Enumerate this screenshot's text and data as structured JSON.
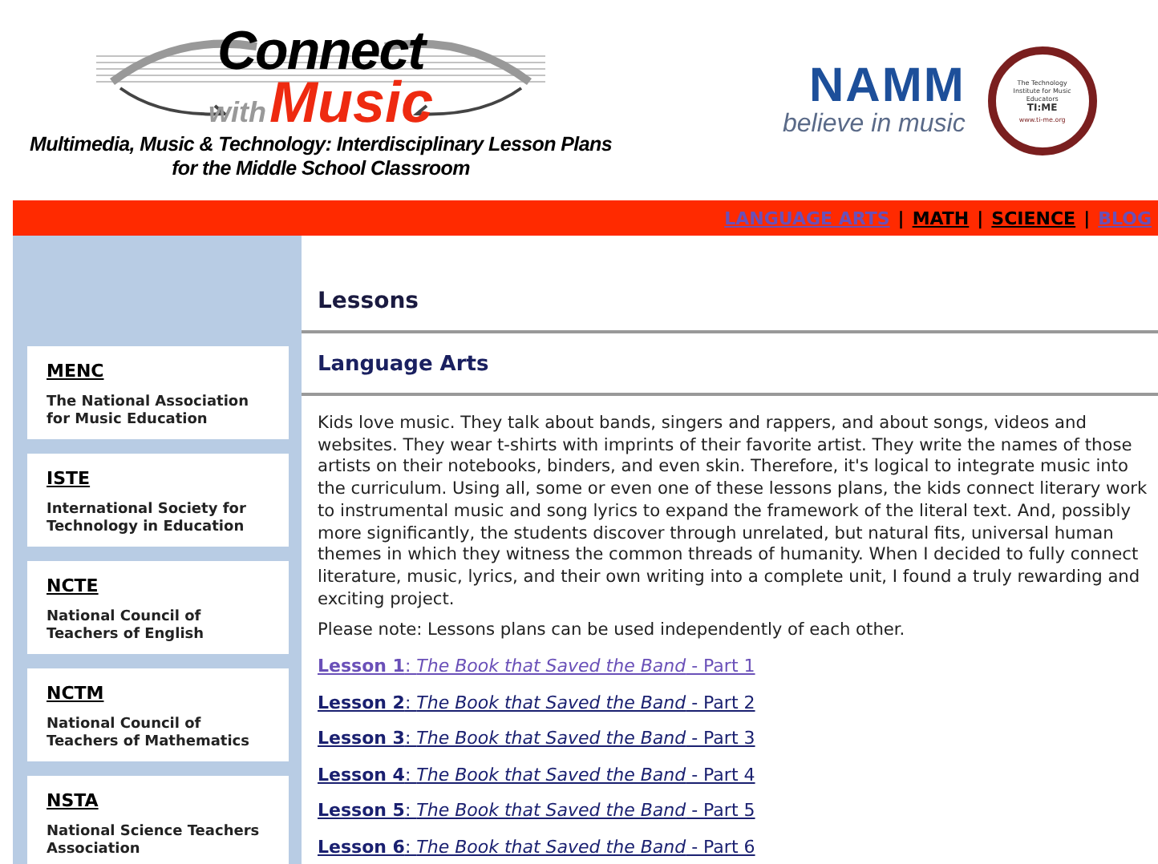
{
  "header": {
    "logo": {
      "top": "Connect",
      "middle": "with",
      "bottom": "Music"
    },
    "tagline": [
      "Multimedia, Music & Technology:  Interdisciplinary Lesson Plans",
      "for the Middle School Classroom"
    ],
    "namm": {
      "name": "NAMM",
      "slogan": "believe in music"
    },
    "time_badge": {
      "caption": "The Technology Institute for Music Educators",
      "name": "TI:ME",
      "url": "www.ti-me.org"
    }
  },
  "nav": [
    {
      "label": "LANGUAGE ARTS",
      "visited": true
    },
    {
      "label": "MATH",
      "visited": false
    },
    {
      "label": "SCIENCE",
      "visited": false
    },
    {
      "label": "BLOG",
      "visited": true
    }
  ],
  "nav_separator": "|",
  "sidebar": [
    {
      "abbr": "MENC",
      "name": "The National Association for Music Education"
    },
    {
      "abbr": "ISTE",
      "name": "International Society for Technology in Education"
    },
    {
      "abbr": "NCTE",
      "name": "National Council of Teachers of English"
    },
    {
      "abbr": "NCTM",
      "name": "National Council of Teachers of Mathematics"
    },
    {
      "abbr": "NSTA",
      "name": "National Science Teachers Association"
    }
  ],
  "main": {
    "title": "Lessons",
    "section": "Language Arts",
    "intro": "Kids love music. They talk about bands, singers and rappers, and about songs, videos and websites. They wear t-shirts with imprints of their favorite artist. They write the names of those artists on their notebooks, binders, and even skin. Therefore, it's logical to integrate music into the curriculum. Using all, some or even one of these lessons plans, the kids connect literary work to instrumental music and song lyrics to expand the framework of the literal text. And, possibly more significantly, the students discover through unrelated, but natural fits, universal human themes in which they witness the common threads of humanity. When I decided to fully connect literature, music, lyrics, and their own writing into a complete unit, I found a truly rewarding and exciting project.",
    "note": "Please note: Lessons plans can be used independently of each other.",
    "lessons": [
      {
        "label": "**Lesson 1**:  *The Book that Saved the Band* - Part 1",
        "visited": true
      },
      {
        "label": "**Lesson 2**:  *The Book that Saved the Band* - Part 2",
        "visited": false
      },
      {
        "label": "**Lesson 3**:  *The Book that Saved the Band* - Part 3",
        "visited": false
      },
      {
        "label": "**Lesson 4**:  *The Book that Saved the Band* - Part 4",
        "visited": false
      },
      {
        "label": "**Lesson 5**:  *The Book that Saved the Band* - Part 5",
        "visited": false
      },
      {
        "label": "**Lesson 6**:  *The Book that Saved the Band* - Part 6",
        "visited": false
      }
    ]
  }
}
